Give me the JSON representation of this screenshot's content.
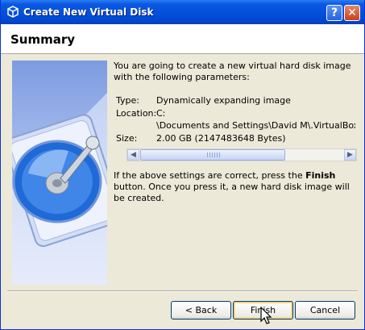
{
  "window": {
    "title": "Create New Virtual Disk",
    "help_label": "?",
    "close_label": "✕"
  },
  "header": {
    "title": "Summary"
  },
  "summary": {
    "intro": "You are going to create a new virtual hard disk image with the following parameters:",
    "params": [
      {
        "label": "Type:",
        "value": "Dynamically expanding image"
      },
      {
        "label": "Location:",
        "value": "C:"
      },
      {
        "label": "",
        "value": "\\Documents and Settings\\David M\\.VirtualBox\\VDI\\L"
      },
      {
        "label": "Size:",
        "value": "2.00 GB (2147483648 Bytes)"
      }
    ],
    "closing_prefix": "If the above settings are correct, press the ",
    "closing_bold": "Finish",
    "closing_suffix": " button. Once you press it, a new hard disk image will be created."
  },
  "buttons": {
    "back": "< Back",
    "finish": "Finish",
    "cancel": "Cancel"
  },
  "icons": {
    "title_icon": "virtualbox-cube-icon",
    "wizard_image": "hard-disk-illustration",
    "cursor": "mouse-pointer-icon"
  },
  "colors": {
    "titlebar": "#0551dc",
    "dialog_bg": "#ece9d8",
    "close_button": "#c9401c"
  }
}
